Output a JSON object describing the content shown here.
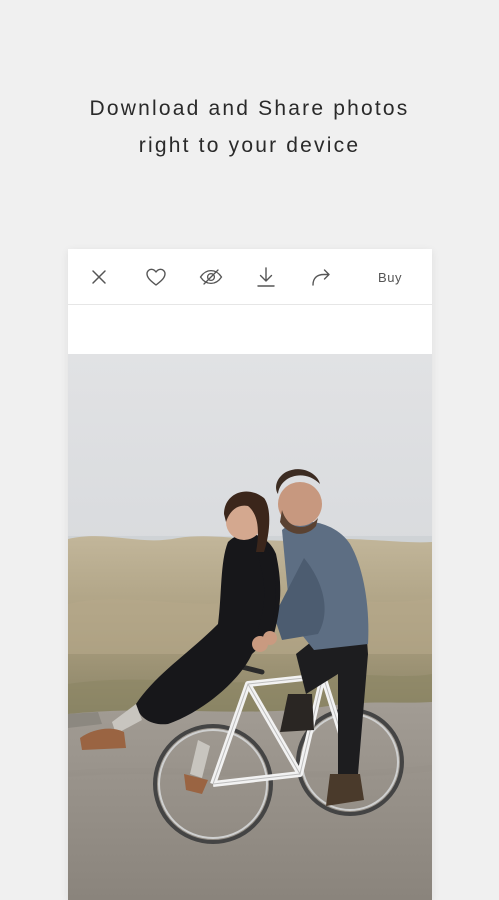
{
  "headline": {
    "line1": "Download and Share photos",
    "line2": "right to your device"
  },
  "toolbar": {
    "close_icon": "close-icon",
    "like_icon": "heart-icon",
    "hide_icon": "eye-slash-icon",
    "download_icon": "download-icon",
    "share_icon": "share-arrow-icon",
    "buy_label": "Buy"
  },
  "photo": {
    "subject": "couple riding a white bicycle on a gravel path by grassy dunes"
  },
  "colors": {
    "background": "#f0f0f0",
    "card": "#ffffff",
    "icon": "#555555",
    "text": "#2a2a2a"
  }
}
